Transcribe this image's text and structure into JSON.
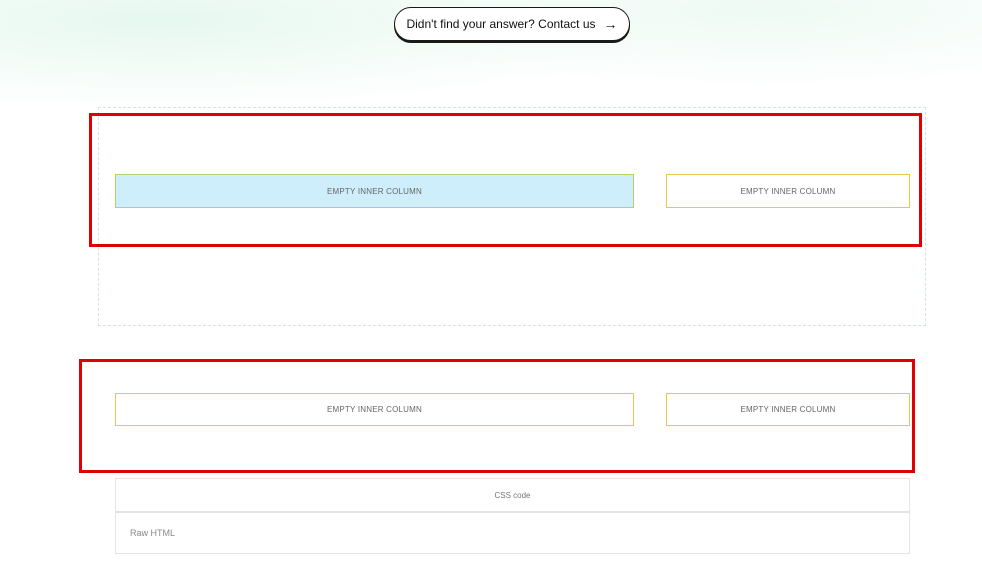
{
  "contact": {
    "label": "Didn't find your answer? Contact us",
    "icon": "arrow-right-icon"
  },
  "rows": [
    {
      "columns": [
        {
          "label": "EMPTY INNER COLUMN",
          "active": true
        },
        {
          "label": "EMPTY INNER COLUMN",
          "active": false
        }
      ]
    },
    {
      "columns": [
        {
          "label": "EMPTY INNER COLUMN",
          "active": false
        },
        {
          "label": "EMPTY INNER COLUMN",
          "active": false
        }
      ]
    }
  ],
  "blocks": {
    "css_code": "CSS code",
    "raw_html": "Raw HTML"
  },
  "colors": {
    "highlight": "#e00000",
    "active_column_bg": "#cfeefb",
    "column_border": "#e6c84a"
  }
}
